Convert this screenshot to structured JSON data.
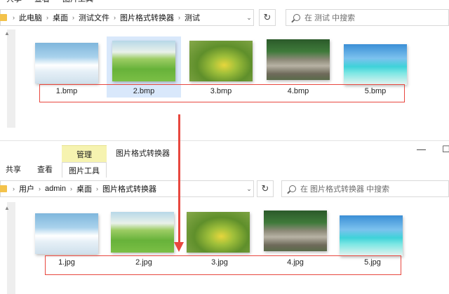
{
  "window1": {
    "ribbon_tabs": [
      "共享",
      "查看",
      "图片工具"
    ],
    "address": {
      "crumbs": [
        "此电脑",
        "桌面",
        "测试文件",
        "图片格式转换器",
        "测试"
      ]
    },
    "search_placeholder": "在 测试 中搜索",
    "files": [
      {
        "name": "1.bmp",
        "image": "sky-clouds"
      },
      {
        "name": "2.bmp",
        "image": "green-meadow",
        "selected": true
      },
      {
        "name": "3.bmp",
        "image": "yellow-flowers"
      },
      {
        "name": "4.bmp",
        "image": "river-stones"
      },
      {
        "name": "5.bmp",
        "image": "tropical-beach"
      }
    ]
  },
  "window2": {
    "context_tab": "管理",
    "title": "图片格式转换器",
    "ribbon_tabs": [
      "共享",
      "查看"
    ],
    "context_subtab": "图片工具",
    "address": {
      "crumbs": [
        "用户",
        "admin",
        "桌面",
        "图片格式转换器"
      ]
    },
    "search_placeholder": "在 图片格式转换器 中搜索",
    "files": [
      {
        "name": "1.jpg",
        "image": "sky-clouds"
      },
      {
        "name": "2.jpg",
        "image": "green-meadow"
      },
      {
        "name": "3.jpg",
        "image": "yellow-flowers"
      },
      {
        "name": "4.jpg",
        "image": "river-stones"
      },
      {
        "name": "5.jpg",
        "image": "tropical-beach"
      }
    ]
  },
  "colors": {
    "annotation": "#e8473f",
    "manage_tab": "#f6f3b0",
    "selection": "#d9e8fb"
  }
}
